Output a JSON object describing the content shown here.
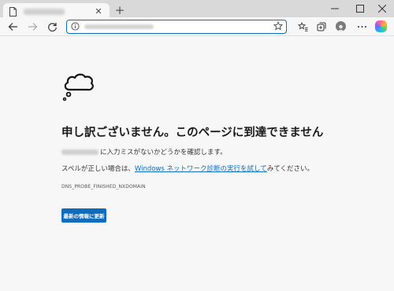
{
  "tab": {
    "close_glyph": "✕",
    "new_tab_glyph": "+"
  },
  "window_controls": {
    "minimize_glyph": "—",
    "maximize_glyph": "☐",
    "close_glyph": "✕"
  },
  "toolbar": {
    "back_glyph": "←",
    "forward_glyph": "→",
    "reload_glyph": "↻",
    "star_glyph": "☆",
    "favorites_glyph": "☆",
    "collections_glyph": "⧉",
    "more_glyph": "···"
  },
  "error_page": {
    "headline": "申し訳ございません。このページに到達できません",
    "line1_suffix": "に入力ミスがないかどうかを確認します。",
    "line2_prefix": "スペルが正しい場合は、",
    "line2_link": "Windows ネットワーク診断の実行を試して",
    "line2_suffix": "みてください。",
    "error_code": "DNS_PROBE_FINISHED_NXDOMAIN",
    "refresh_button": "最新の情報に更新"
  },
  "colors": {
    "accent": "#0f6cbd",
    "page_background": "#f7f7f7",
    "tabstrip_background": "#d9d9d9"
  },
  "icons": [
    "page-icon",
    "back-arrow-icon",
    "forward-arrow-icon",
    "reload-icon",
    "info-icon",
    "star-icon",
    "favorites-icon",
    "collections-icon",
    "avatar-icon",
    "more-icon",
    "copilot-icon",
    "cloud-icon"
  ]
}
